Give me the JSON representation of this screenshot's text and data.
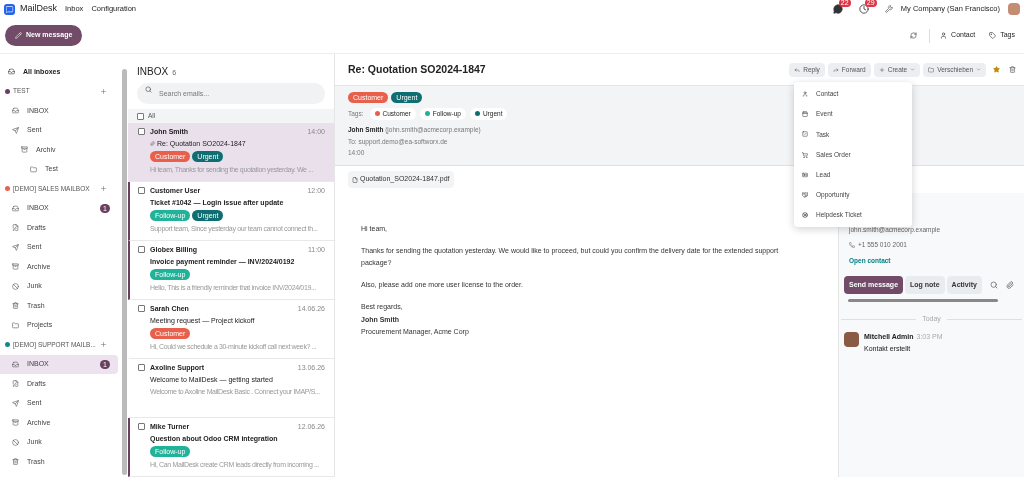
{
  "topbar": {
    "app_name": "MailDesk",
    "menu": [
      "Inbox",
      "Configuration"
    ],
    "chat_badge": "22",
    "activity_badge": "29",
    "company": "My Company (San Francisco)"
  },
  "actionbar": {
    "new_message": "New message",
    "contact": "Contact",
    "tags": "Tags"
  },
  "sidebar": {
    "all_inboxes": "All inboxes",
    "accounts": [
      {
        "name": "TEST",
        "color": "#6b3f5e",
        "folders": [
          {
            "kind": "inbox",
            "label": "INBOX",
            "selected": false
          },
          {
            "kind": "sent",
            "label": "Sent",
            "selected": false,
            "children": [
              {
                "kind": "archive",
                "label": "Archiv",
                "selected": false,
                "children": [
                  {
                    "kind": "folder",
                    "label": "Test",
                    "selected": false
                  }
                ]
              }
            ]
          }
        ]
      },
      {
        "name": "[DEMO] SALES MAILBOX",
        "color": "#e8604c",
        "folders": [
          {
            "kind": "inbox",
            "label": "INBOX",
            "count": "1",
            "selected": false
          },
          {
            "kind": "drafts",
            "label": "Drafts",
            "selected": false
          },
          {
            "kind": "sent",
            "label": "Sent",
            "selected": false
          },
          {
            "kind": "archive",
            "label": "Archive",
            "selected": false
          },
          {
            "kind": "junk",
            "label": "Junk",
            "selected": false
          },
          {
            "kind": "trash",
            "label": "Trash",
            "selected": false
          },
          {
            "kind": "folder",
            "label": "Projects",
            "selected": false
          }
        ]
      },
      {
        "name": "[DEMO] SUPPORT MAILB...",
        "color": "#0f8a8a",
        "folders": [
          {
            "kind": "inbox",
            "label": "INBOX",
            "count": "1",
            "selected": true
          },
          {
            "kind": "drafts",
            "label": "Drafts",
            "selected": false
          },
          {
            "kind": "sent",
            "label": "Sent",
            "selected": false
          },
          {
            "kind": "archive",
            "label": "Archive",
            "selected": false
          },
          {
            "kind": "junk",
            "label": "Junk",
            "selected": false
          },
          {
            "kind": "trash",
            "label": "Trash",
            "selected": false
          }
        ]
      }
    ]
  },
  "list": {
    "title": "INBOX",
    "count": "6",
    "search_placeholder": "Search emails...",
    "select_all": {
      "label": "All",
      "checked": false
    },
    "items": [
      {
        "sender": "John Smith",
        "time": "14:00",
        "subject": "Re: Quotation SO2024-1847",
        "attachment": true,
        "unread": false,
        "selected": true,
        "checked": false,
        "tags": [
          {
            "label": "Customer",
            "color": "#e8604c"
          },
          {
            "label": "Urgent",
            "color": "#0f6e72"
          }
        ],
        "preview": "Hi team, Thanks for sending the quotation yesterday. We ..."
      },
      {
        "sender": "Customer User",
        "time": "12:00",
        "subject": "Ticket #1042 — Login issue after update",
        "attachment": false,
        "unread": true,
        "selected": false,
        "checked": false,
        "tags": [
          {
            "label": "Follow-up",
            "color": "#21b39a"
          },
          {
            "label": "Urgent",
            "color": "#0f6e72"
          }
        ],
        "preview": "Support team, Since yesterday our team cannot connect th..."
      },
      {
        "sender": "Globex Billing",
        "time": "11:00",
        "subject": "Invoice payment reminder — INV/2024/0192",
        "attachment": false,
        "unread": true,
        "selected": false,
        "checked": false,
        "tags": [
          {
            "label": "Follow-up",
            "color": "#21b39a"
          }
        ],
        "preview": "Hello, This is a friendly reminder that invoice INV/2024/019..."
      },
      {
        "sender": "Sarah Chen",
        "time": "14.06.26",
        "subject": "Meeting request — Project kickoff",
        "attachment": false,
        "unread": false,
        "selected": false,
        "checked": false,
        "tags": [
          {
            "label": "Customer",
            "color": "#e8604c"
          }
        ],
        "preview": "Hi, Could we schedule a 30-minute kickoff call next week? ..."
      },
      {
        "sender": "Axoline Support",
        "time": "13.06.26",
        "subject": "Welcome to MailDesk — getting started",
        "attachment": false,
        "unread": false,
        "selected": false,
        "checked": false,
        "preview": "Welcome to Axoline MailDesk Basic . Connect your IMAP/S..."
      },
      {
        "sender": "Mike Turner",
        "time": "12.06.26",
        "subject": "Question about Odoo CRM integration",
        "attachment": false,
        "unread": true,
        "selected": false,
        "checked": false,
        "tags": [
          {
            "label": "Follow-up",
            "color": "#21b39a"
          }
        ],
        "preview": "Hi, Can MailDesk create CRM leads directly from incoming ..."
      }
    ]
  },
  "message": {
    "subject": "Re: Quotation SO2024-1847",
    "toolbar": {
      "reply": "Reply",
      "forward": "Forward",
      "create": "Create",
      "move": "Verschieben",
      "starred": true
    },
    "badges": [
      {
        "label": "Customer",
        "color": "#e8604c"
      },
      {
        "label": "Urgent",
        "color": "#0f6e72"
      }
    ],
    "tags_label": "Tags:",
    "tags": [
      {
        "label": "Customer",
        "color": "#e8604c"
      },
      {
        "label": "Follow-up",
        "color": "#21b39a"
      },
      {
        "label": "Urgent",
        "color": "#0f6e72"
      }
    ],
    "from_name": "John Smith",
    "from_email": "(john.smith@acmecorp.example)",
    "to": "To: support.demo@ea-softworx.de",
    "time": "14:00",
    "attachment": "Quotation_SO2024-1847.pdf",
    "body": [
      {
        "kind": "text",
        "text": "Hi team,"
      },
      {
        "kind": "text",
        "text": "Thanks for sending the quotation yesterday. We would like to proceed, but could you confirm the delivery date for the extended support package?"
      },
      {
        "kind": "text",
        "text": "Also, please add one more user license to the order."
      },
      {
        "kind": "signature",
        "lines": [
          "Best regards,",
          "John Smith",
          "Procurement Manager, Acme Corp"
        ]
      }
    ]
  },
  "create_menu": [
    {
      "kind": "contact",
      "label": "Contact"
    },
    {
      "kind": "event",
      "label": "Event"
    },
    {
      "kind": "task",
      "label": "Task"
    },
    {
      "kind": "sales_order",
      "label": "Sales Order"
    },
    {
      "kind": "lead",
      "label": "Lead"
    },
    {
      "kind": "opportunity",
      "label": "Opportunity"
    },
    {
      "kind": "helpdesk",
      "label": "Helpdesk Ticket"
    }
  ],
  "chatter": {
    "email": "john.smith@acmecorp.example",
    "phone": "+1 555 010 2001",
    "open_contact": "Open contact",
    "tabs": [
      {
        "label": "Send message",
        "selected": true
      },
      {
        "label": "Log note",
        "selected": false
      },
      {
        "label": "Activity",
        "selected": false
      }
    ],
    "divider": "Today",
    "messages": [
      {
        "author": "Mitchell Admin",
        "time": "3:03 PM",
        "text": "Kontakt erstellt"
      }
    ]
  }
}
